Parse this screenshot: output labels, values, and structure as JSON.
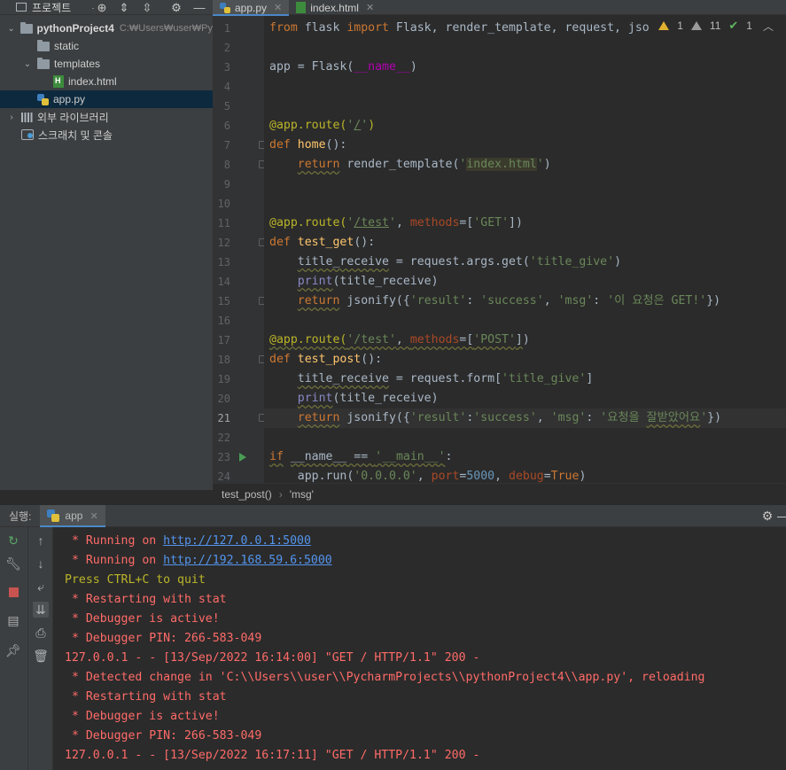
{
  "project_panel": {
    "title": "프로젝트",
    "tree": [
      {
        "label": "pythonProject4",
        "hint": "C:₩Users₩user₩Py",
        "type": "project",
        "indent": 0,
        "arrow": "down"
      },
      {
        "label": "static",
        "type": "folder",
        "indent": 1,
        "arrow": ""
      },
      {
        "label": "templates",
        "type": "folder",
        "indent": 1,
        "arrow": "down"
      },
      {
        "label": "index.html",
        "type": "html",
        "indent": 2,
        "arrow": ""
      },
      {
        "label": "app.py",
        "type": "py",
        "indent": 1,
        "arrow": "",
        "selected": true
      },
      {
        "label": "외부 라이브러리",
        "type": "lib",
        "indent": 0,
        "arrow": "right"
      },
      {
        "label": "스크래치 및 콘솔",
        "type": "scratch",
        "indent": 0,
        "arrow": ""
      }
    ]
  },
  "tabs": [
    {
      "label": "app.py",
      "active": true,
      "icon": "python-file-icon"
    },
    {
      "label": "index.html",
      "active": false,
      "icon": "html-file-icon"
    }
  ],
  "inspection": {
    "warnings": "1",
    "weak_warnings": "11",
    "ok": "1"
  },
  "code_lines": [
    {
      "n": "1",
      "html": "<span class='kw'>from</span> flask <span class='kw'>import</span> Flask, render_template, request, jsonif"
    },
    {
      "n": "2",
      "html": ""
    },
    {
      "n": "3",
      "html": "app = Flask(<span class='dunder'>__name__</span>)"
    },
    {
      "n": "4",
      "html": ""
    },
    {
      "n": "5",
      "html": ""
    },
    {
      "n": "6",
      "html": "<span class='deco'>@app.route(</span><span class='str'>'<u>/</u>'</span><span class='deco'>)</span>"
    },
    {
      "n": "7",
      "html": "<span class='kw'>def</span> <span class='fn'>home</span>():"
    },
    {
      "n": "8",
      "html": "    <span class='kw squig'>return</span> render_template(<span class='str'>'<span class='hl'>index.html</span>'</span>)"
    },
    {
      "n": "9",
      "html": ""
    },
    {
      "n": "10",
      "html": ""
    },
    {
      "n": "11",
      "html": "<span class='deco'>@app.route(</span><span class='str'>'<u>/test</u>'</span>, <span class='param'>methods</span>=[<span class='str'>'GET'</span>])"
    },
    {
      "n": "12",
      "html": "<span class='kw'>def</span> <span class='fn'>test_get</span>():"
    },
    {
      "n": "13",
      "html": "    <span class='squig'>title_receive</span> = request.args.get(<span class='str'>'title_give'</span>)"
    },
    {
      "n": "14",
      "html": "    <span class='bi squig'>print</span>(title_receive)"
    },
    {
      "n": "15",
      "html": "    <span class='kw squig'>return</span> jsonify({<span class='str'>'result'</span>: <span class='str'>'success'</span>, <span class='str'>'msg'</span>: <span class='str'>'이 요청은 GET!'</span>})"
    },
    {
      "n": "16",
      "html": ""
    },
    {
      "n": "17",
      "html": "<span class='deco squig'>@app.route(</span><span class='str squig'>'/test'</span><span class='squig'>, </span><span class='param squig'>methods</span><span class='squig'>=[</span><span class='str squig'>'POST'</span><span class='squig'>]</span>)"
    },
    {
      "n": "18",
      "html": "<span class='kw'>def</span> <span class='fn'>test_post</span>():"
    },
    {
      "n": "19",
      "html": "    <span class='squig'>title_receive</span> = request.form[<span class='str'>'title_give'</span>]"
    },
    {
      "n": "20",
      "html": "    <span class='bi squig'>print</span>(title_receive)"
    },
    {
      "n": "21",
      "html": "    <span class='kw squig'>return</span> jsonify({<span class='str'>'result'</span>:<span class='str'>'success'</span>, <span class='str'>'msg'</span>: <span class='str'>'요청을 <span class='squig'>잘받았어요</span>'</span>})",
      "current": true
    },
    {
      "n": "22",
      "html": ""
    },
    {
      "n": "23",
      "html": "<span class='kw squig'>if</span> <span class='squig'>__name__ == </span><span class='str squig'>'__main__'</span>:"
    },
    {
      "n": "24",
      "html": "    app.run(<span class='str'>'0.0.0.0'</span>, <span class='param'>port</span>=<span class='num'>5000</span>, <span class='param'>debug</span>=<span class='kw'>True</span>)"
    }
  ],
  "breadcrumb": [
    "test_post()",
    "'msg'"
  ],
  "run_panel": {
    "label": "실행:",
    "tab": "app"
  },
  "console_lines": [
    {
      "text": " * Running on ",
      "link": "http://127.0.0.1:5000",
      "color": "red"
    },
    {
      "text": " * Running on ",
      "link": "http://192.168.59.6:5000",
      "color": "red"
    },
    {
      "text": "Press CTRL+C to quit",
      "color": "yellow"
    },
    {
      "text": " * Restarting with stat",
      "color": "red"
    },
    {
      "text": " * Debugger is active!",
      "color": "red"
    },
    {
      "text": " * Debugger PIN: 266-583-049",
      "color": "red"
    },
    {
      "text": "127.0.0.1 - - [13/Sep/2022 16:14:00] \"GET / HTTP/1.1\" 200 -",
      "color": "red"
    },
    {
      "text": " * Detected change in 'C:\\\\Users\\\\user\\\\PycharmProjects\\\\pythonProject4\\\\app.py', reloading",
      "color": "red"
    },
    {
      "text": " * Restarting with stat",
      "color": "red"
    },
    {
      "text": " * Debugger is active!",
      "color": "red"
    },
    {
      "text": " * Debugger PIN: 266-583-049",
      "color": "red"
    },
    {
      "text": "127.0.0.1 - - [13/Sep/2022 16:17:11] \"GET / HTTP/1.1\" 200 -",
      "color": "red"
    }
  ],
  "colors": {
    "accent": "#4a88c7",
    "console_error": "#ff6b68",
    "console_info": "#bbb529",
    "link": "#5394ec"
  }
}
